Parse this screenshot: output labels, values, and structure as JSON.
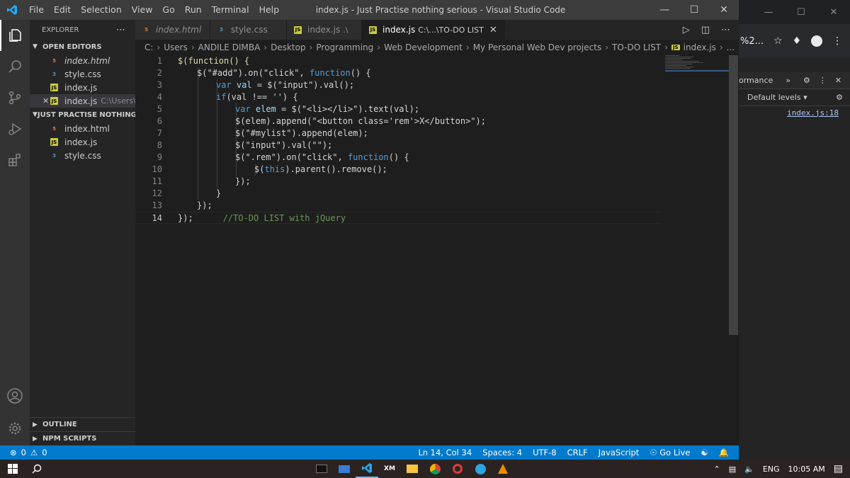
{
  "window": {
    "title": "index.js - Just Practise nothing serious - Visual Studio Code",
    "menu": [
      "File",
      "Edit",
      "Selection",
      "View",
      "Go",
      "Run",
      "Terminal",
      "Help"
    ]
  },
  "sidebar": {
    "header": "EXPLORER",
    "open_editors_label": "OPEN EDITORS",
    "open_editors": [
      {
        "name": "index.html",
        "icon": "html-file-icon",
        "italic": true
      },
      {
        "name": "style.css",
        "icon": "css-file-icon"
      },
      {
        "name": "index.js",
        "icon": "js-file-icon"
      },
      {
        "name": "index.js",
        "icon": "js-file-icon",
        "path": "C:\\Users\\A...",
        "selected": true
      }
    ],
    "folder_label": "JUST PRACTISE NOTHING ...",
    "folder_files": [
      {
        "name": "index.html",
        "icon": "html-file-icon"
      },
      {
        "name": "index.js",
        "icon": "js-file-icon"
      },
      {
        "name": "style.css",
        "icon": "css-file-icon"
      }
    ],
    "outline_label": "OUTLINE",
    "npm_label": "NPM SCRIPTS"
  },
  "tabs": [
    {
      "name": "index.html",
      "icon": "html-file-icon",
      "italic": true
    },
    {
      "name": "style.css",
      "icon": "css-file-icon"
    },
    {
      "name": "index.js",
      "icon": "js-file-icon",
      "sub": ".\\"
    },
    {
      "name": "index.js",
      "icon": "js-file-icon",
      "sub": "C:\\...\\TO-DO LIST",
      "active": true
    }
  ],
  "breadcrumb": [
    "C:",
    "Users",
    "ANDILE DIMBA",
    "Desktop",
    "Programming",
    "Web Development",
    "My Personal Web Dev projects",
    "TO-DO LIST",
    "index.js",
    "..."
  ],
  "code_lines": [
    "1",
    "2",
    "3",
    "4",
    "5",
    "6",
    "7",
    "8",
    "9",
    "10",
    "11",
    "12",
    "13",
    "14"
  ],
  "code": {
    "l1": "$(function() {",
    "l2a": "$(\"#add\").on(\"click\", ",
    "l2b": "function",
    "l2c": "() {",
    "l3a": "var ",
    "l3b": "val",
    "l3c": " = $(\"input\").val();",
    "l4a": "if",
    "l4b": "(val !== '') {",
    "l5a": "var ",
    "l5b": "elem",
    "l5c": " = $(\"<li></li>\").text(val);",
    "l6": "$(elem).append(\"<button class='rem'>X</button>\");",
    "l7": "$(\"#mylist\").append(elem);",
    "l8": "$(\"input\").val(\"\");",
    "l9a": "$(\".rem\").on(\"click\", ",
    "l9b": "function",
    "l9c": "() {",
    "l10a": "$(",
    "l10b": "this",
    "l10c": ").parent().remove();",
    "l11": "});",
    "l12": "}",
    "l13": "});",
    "l14a": "});",
    "l14b": "//TO-DO LIST with jQuery"
  },
  "statusbar": {
    "errors": "0",
    "warnings": "0",
    "position": "Ln 14, Col 34",
    "spaces": "Spaces: 4",
    "encoding": "UTF-8",
    "eol": "CRLF",
    "language": "JavaScript",
    "golive": "Go Live"
  },
  "browser": {
    "url_fragment": "%2...",
    "devtools_tab": "ormance",
    "levels": "Default levels ▾",
    "log_link": "index.js:18"
  },
  "taskbar": {
    "lang": "ENG",
    "time": "10:05 AM"
  },
  "colors": {
    "accent": "#007acc",
    "keyword": "#569cd6",
    "string": "#ce9178",
    "comment": "#6a9955"
  }
}
